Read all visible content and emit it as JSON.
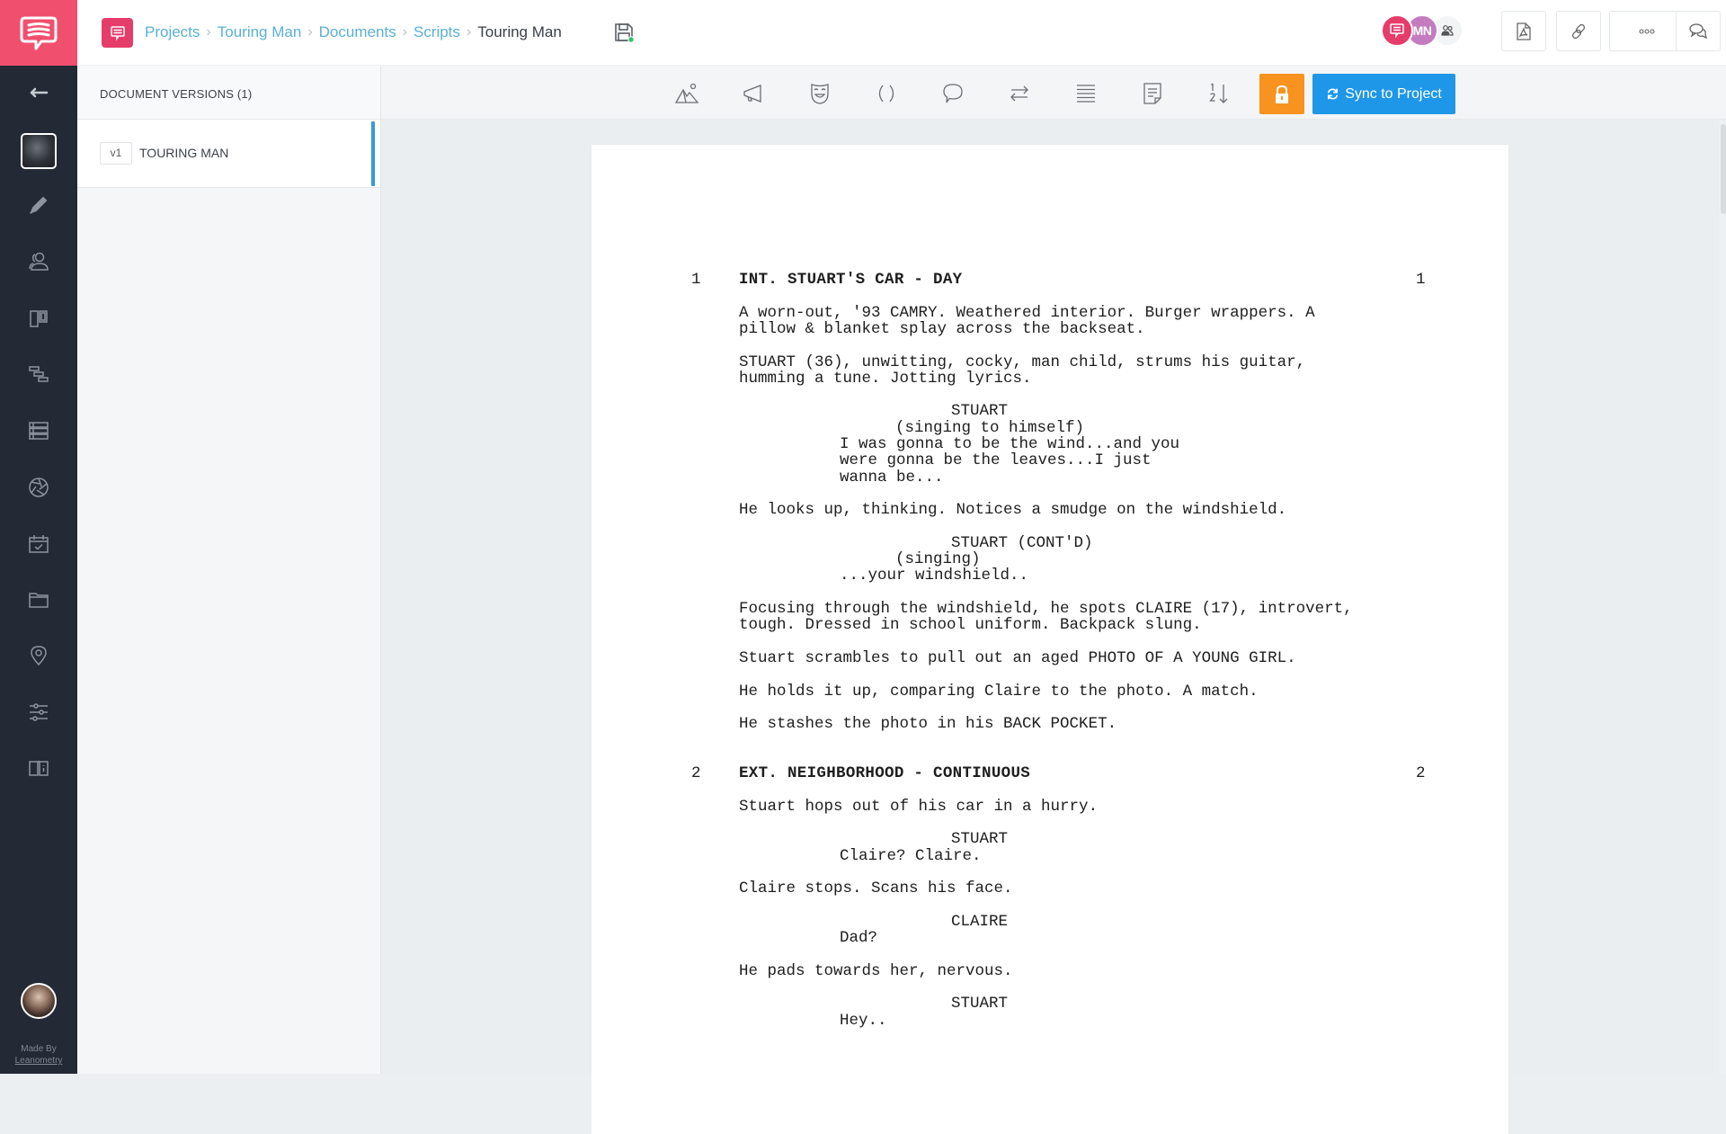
{
  "app": {
    "logo_icon": "speech-bubble-logo-icon",
    "made_by_label": "Made By",
    "made_by_brand": "Leanometry"
  },
  "rail": {
    "items": [
      {
        "name": "back",
        "icon": "arrow-left-icon"
      },
      {
        "name": "project-thumbnail",
        "icon": "project-image"
      },
      {
        "name": "write",
        "icon": "pencil-icon"
      },
      {
        "name": "characters",
        "icon": "users-icon"
      },
      {
        "name": "storyboard",
        "icon": "columns-icon"
      },
      {
        "name": "schedule",
        "icon": "gantt-icon"
      },
      {
        "name": "shot-list",
        "icon": "list-icon"
      },
      {
        "name": "camera",
        "icon": "aperture-icon"
      },
      {
        "name": "calendar",
        "icon": "calendar-check-icon"
      },
      {
        "name": "files",
        "icon": "folder-icon"
      },
      {
        "name": "locations",
        "icon": "map-pin-icon"
      },
      {
        "name": "settings",
        "icon": "sliders-icon"
      },
      {
        "name": "guide",
        "icon": "book-icon"
      }
    ]
  },
  "header": {
    "breadcrumbs": [
      "Projects",
      "Touring Man",
      "Documents",
      "Scripts",
      "Touring Man"
    ],
    "avatars": [
      {
        "label": "",
        "icon": "speech-bubble-icon",
        "color": "#e63c6a"
      },
      {
        "label": "MN",
        "color": "#c47bbf"
      },
      {
        "label": "",
        "icon": "team-icon",
        "color": "#f2f4f6"
      }
    ],
    "actions": [
      "export-pdf",
      "share-link",
      "more",
      "comments"
    ]
  },
  "versions": {
    "title": "DOCUMENT VERSIONS (1)",
    "items": [
      {
        "tag": "v1",
        "name": "TOURING MAN",
        "active": true
      }
    ]
  },
  "toolbar": {
    "tools": [
      "scene-heading",
      "action",
      "character",
      "parenthetical",
      "dialogue",
      "transition",
      "general",
      "note",
      "scene-numbering"
    ],
    "lock_icon": "lock-icon",
    "sync_label": "Sync to Project",
    "accent_colors": {
      "lock": "#f7931e",
      "sync": "#1f97e8",
      "brand": "#f0506e"
    }
  },
  "script": {
    "scenes": [
      {
        "number": "1",
        "heading": "INT. STUART'S CAR - DAY",
        "elements": [
          {
            "type": "action",
            "text": "A worn-out, '93 CAMRY. Weathered interior. Burger wrappers. A\npillow & blanket splay across the backseat."
          },
          {
            "type": "action",
            "text": "STUART (36), unwitting, cocky, man child, strums his guitar,\nhumming a tune. Jotting lyrics."
          },
          {
            "type": "character",
            "text": "STUART"
          },
          {
            "type": "parenthetical",
            "text": "(singing to himself)"
          },
          {
            "type": "dialogue",
            "text": "I was gonna to be the wind...and you\nwere gonna be the leaves...I just\nwanna be..."
          },
          {
            "type": "action",
            "text": "He looks up, thinking. Notices a smudge on the windshield."
          },
          {
            "type": "character",
            "text": "STUART (CONT'D)"
          },
          {
            "type": "parenthetical",
            "text": "(singing)"
          },
          {
            "type": "dialogue",
            "text": "...your windshield.."
          },
          {
            "type": "action",
            "text": "Focusing through the windshield, he spots CLAIRE (17), introvert,\ntough. Dressed in school uniform. Backpack slung."
          },
          {
            "type": "action",
            "text": "Stuart scrambles to pull out an aged PHOTO OF A YOUNG GIRL."
          },
          {
            "type": "action",
            "text": "He holds it up, comparing Claire to the photo. A match."
          },
          {
            "type": "action",
            "text": "He stashes the photo in his BACK POCKET."
          }
        ]
      },
      {
        "number": "2",
        "heading": "EXT. NEIGHBORHOOD - CONTINUOUS",
        "elements": [
          {
            "type": "action",
            "text": "Stuart hops out of his car in a hurry."
          },
          {
            "type": "character",
            "text": "STUART"
          },
          {
            "type": "dialogue",
            "text": "Claire? Claire."
          },
          {
            "type": "action",
            "text": "Claire stops. Scans his face."
          },
          {
            "type": "character",
            "text": "CLAIRE"
          },
          {
            "type": "dialogue",
            "text": "Dad?"
          },
          {
            "type": "action",
            "text": "He pads towards her, nervous."
          },
          {
            "type": "character",
            "text": "STUART"
          },
          {
            "type": "dialogue",
            "text": "Hey.."
          }
        ]
      }
    ]
  }
}
